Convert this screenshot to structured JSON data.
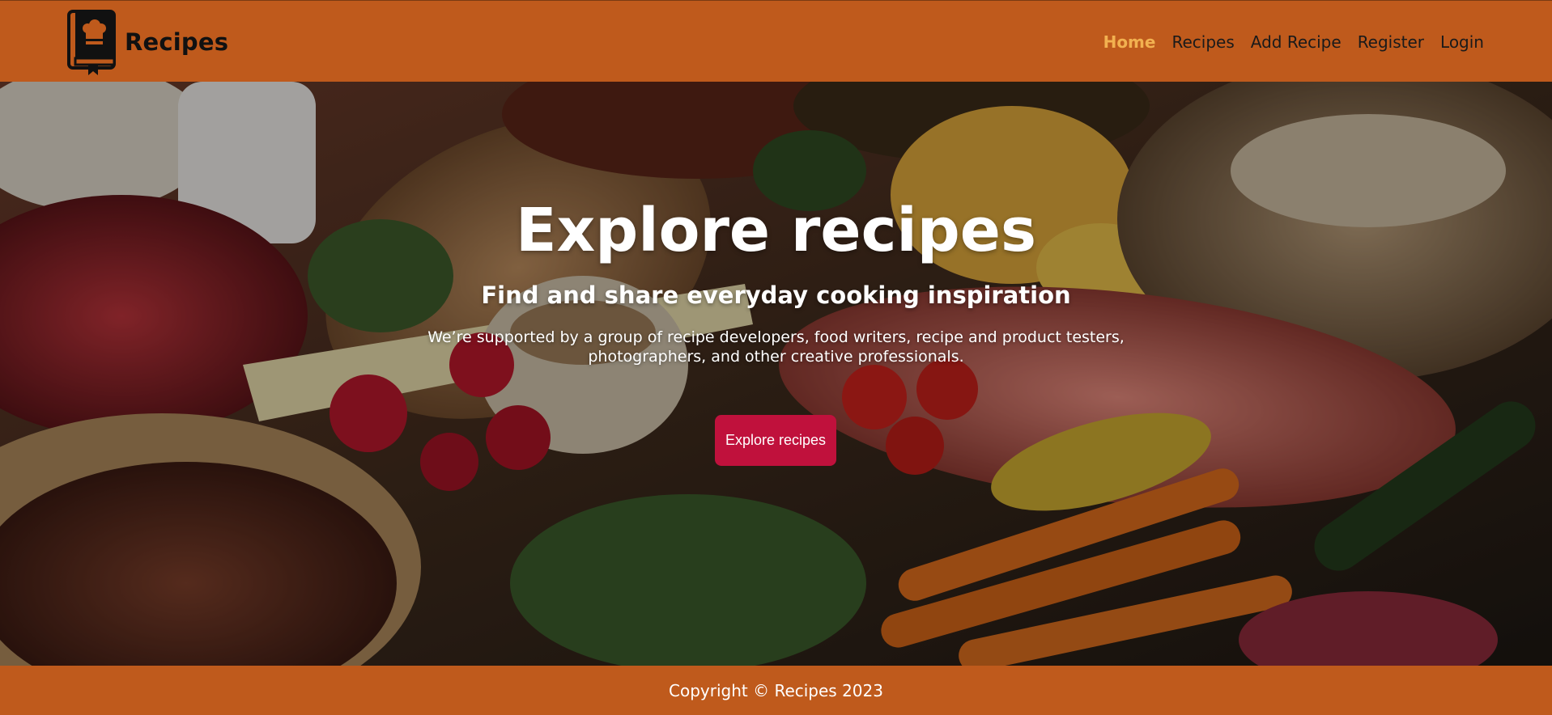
{
  "header": {
    "brand_name": "Recipes",
    "logo_icon": "chef-book-icon",
    "nav": [
      {
        "label": "Home",
        "active": true
      },
      {
        "label": "Recipes",
        "active": false
      },
      {
        "label": "Add Recipe",
        "active": false
      },
      {
        "label": "Register",
        "active": false
      },
      {
        "label": "Login",
        "active": false
      }
    ]
  },
  "hero": {
    "title": "Explore recipes",
    "subtitle": "Find and share everyday cooking inspiration",
    "text": "We’re supported by a group of recipe developers, food writers, recipe and product testers, photographers, and other creative professionals.",
    "button_label": "Explore recipes",
    "background_image": "assorted-food-photo"
  },
  "footer": {
    "copyright": "Copyright © Recipes 2023"
  },
  "colors": {
    "header_bg": "#bf5a1c",
    "footer_bg": "#bf5a1c",
    "nav_active": "#f2b150",
    "button_bg": "#c0113c"
  }
}
